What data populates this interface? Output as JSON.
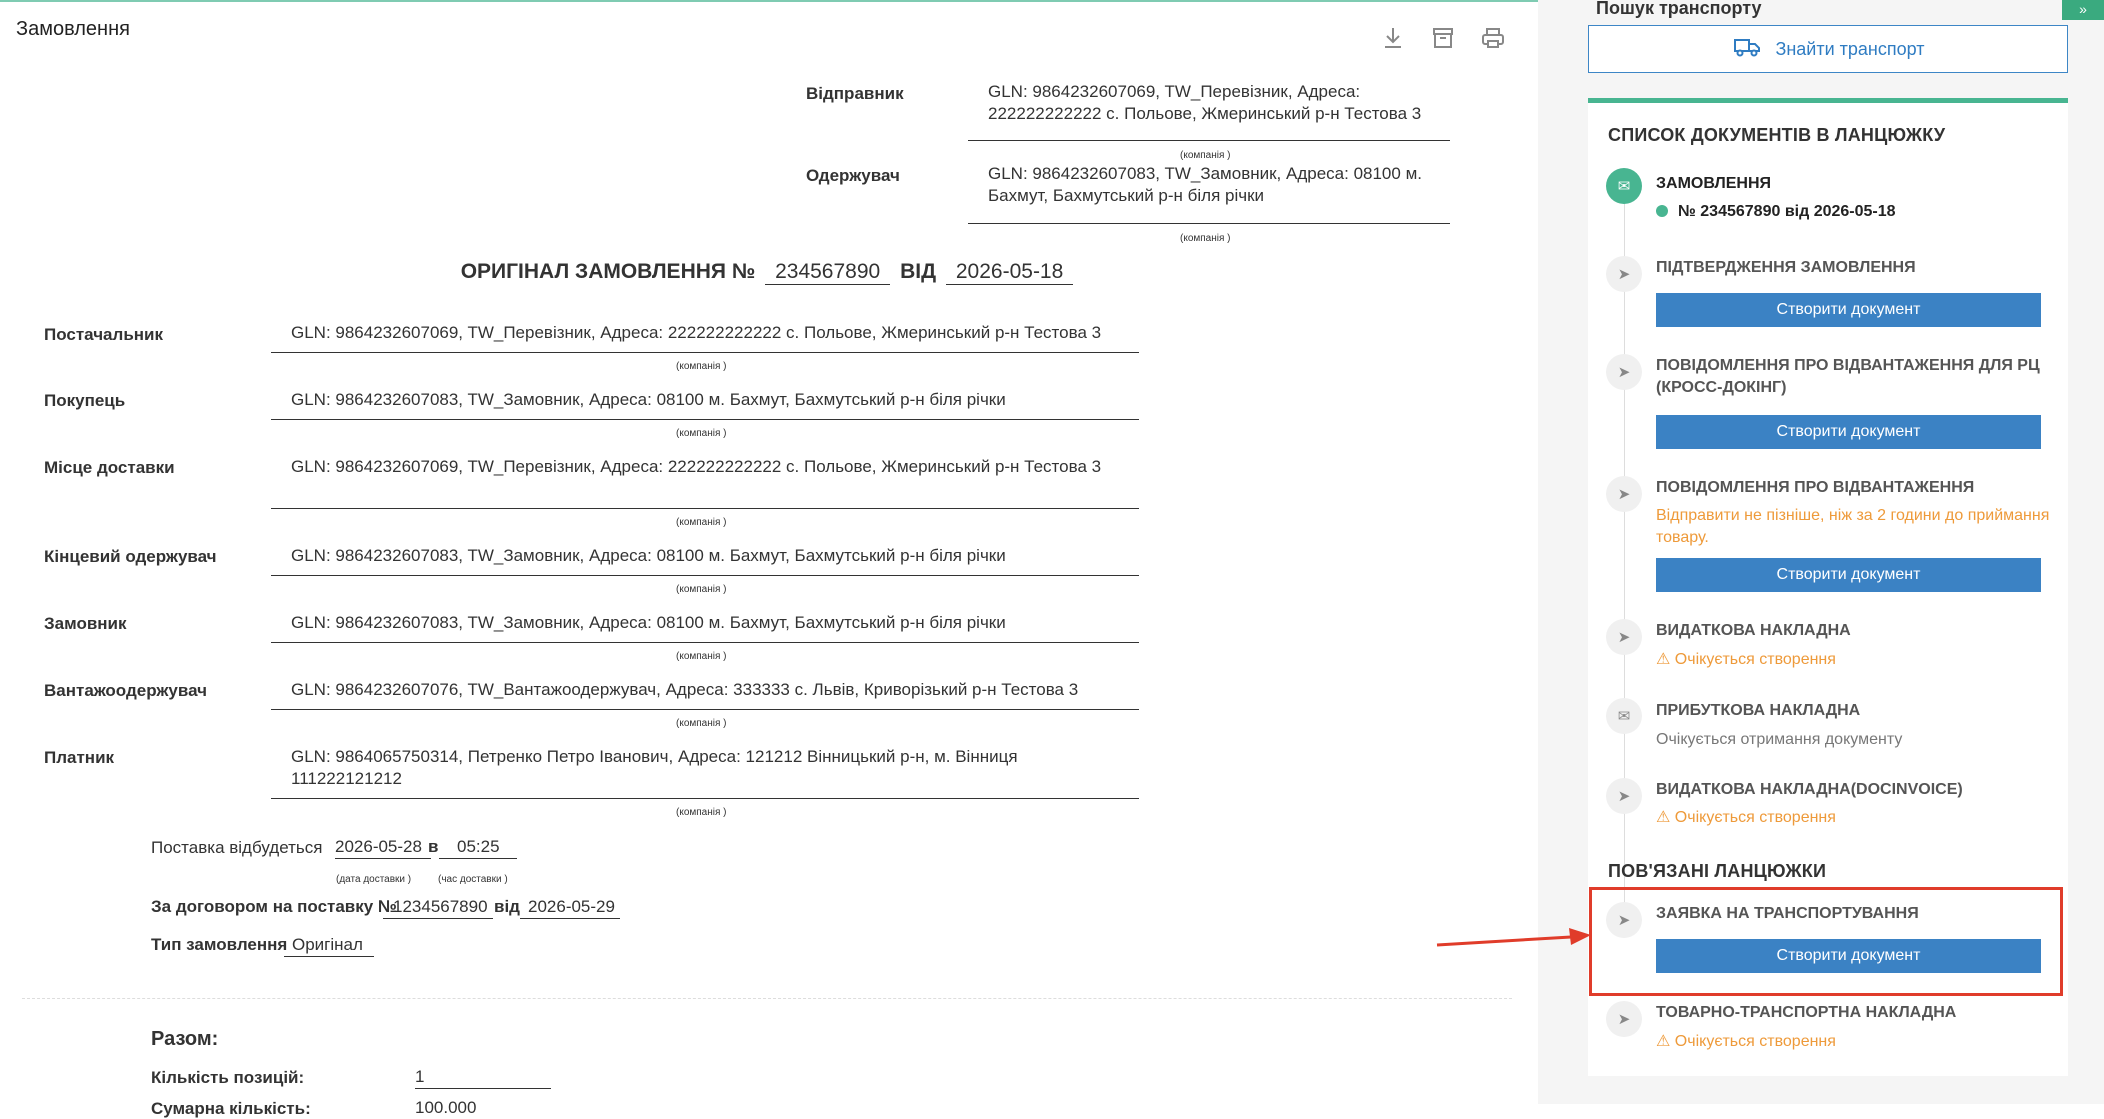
{
  "page": {
    "title": "Замовлення",
    "tool_icons": [
      "download-icon",
      "archive-icon",
      "print-icon"
    ]
  },
  "parties": {
    "caption": "(компанія )",
    "sender": {
      "label": "Відправник",
      "value": "GLN: 9864232607069, TW_Перевізник, Адреса: 222222222222 с. Польове, Жмеринський р-н Тестова 3"
    },
    "receiver": {
      "label": "Одержувач",
      "value": "GLN: 9864232607083, TW_Замовник, Адреса: 08100 м. Бахмут, Бахмутський р-н біля річки"
    }
  },
  "order_header": {
    "prefix": "ОРИГІНАЛ ЗАМОВЛЕННЯ №",
    "number": "234567890",
    "from": "ВІД",
    "date": "2026-05-18"
  },
  "fields": [
    {
      "label": "Постачальник",
      "value": "GLN: 9864232607069, TW_Перевізник, Адреса: 222222222222 с. Польове, Жмеринський р-н Тестова 3"
    },
    {
      "label": "Покупець",
      "value": "GLN: 9864232607083, TW_Замовник, Адреса: 08100 м. Бахмут, Бахмутський р-н біля річки"
    },
    {
      "label": "Місце доставки",
      "value": "GLN: 9864232607069, TW_Перевізник, Адреса: 222222222222 с. Польове, Жмеринський р-н Тестова 3"
    },
    {
      "label": "Кінцевий одержувач",
      "value": "GLN: 9864232607083, TW_Замовник, Адреса: 08100 м. Бахмут, Бахмутський р-н біля річки"
    },
    {
      "label": "Замовник",
      "value": "GLN: 9864232607083, TW_Замовник, Адреса: 08100 м. Бахмут, Бахмутський р-н біля річки"
    },
    {
      "label": "Вантажоодержувач",
      "value": "GLN: 9864232607076, TW_Вантажоодержувач, Адреса: 333333 с. Львів, Криворізький р-н Тестова 3"
    },
    {
      "label": "Платник",
      "value": "GLN: 9864065750314, Петренко Петро Іванович, Адреса: 121212 Вінницький р-н, м. Вінниця 111222121212"
    }
  ],
  "delivery": {
    "label": "Поставка відбудеться",
    "date": "2026-05-28",
    "at": "в",
    "time": "05:25",
    "date_caption": "(дата доставки )",
    "time_caption": "(час доставки )"
  },
  "contract": {
    "label": "За договором на поставку №",
    "number": "1234567890",
    "from": "від",
    "date": "2026-05-29"
  },
  "order_type": {
    "label": "Тип замовлення",
    "value": "Оригінал"
  },
  "totals": {
    "title": "Разом:",
    "positions_label": "Кількість позицій:",
    "positions_value": "1",
    "sum_label": "Сумарна кількість:",
    "sum_value": "100.000"
  },
  "sidebar": {
    "transport_search_title": "Пошук транспорту",
    "find_button": "Знайти транспорт",
    "chain_title": "СПИСОК ДОКУМЕНТІВ В ЛАНЦЮЖКУ",
    "create_button": "Створити документ",
    "items": [
      {
        "title": "ЗАМОВЛЕННЯ",
        "sub": "№ 234567890 від 2026-05-18",
        "icon": "envelope-icon"
      },
      {
        "title": "ПІДТВЕРДЖЕННЯ ЗАМОВЛЕННЯ",
        "icon": "send-icon"
      },
      {
        "title": "ПОВІДОМЛЕННЯ ПРО ВІДВАНТАЖЕННЯ ДЛЯ РЦ (КРОСС-ДОКІНГ)",
        "icon": "send-icon"
      },
      {
        "title": "ПОВІДОМЛЕННЯ ПРО ВІДВАНТАЖЕННЯ",
        "sub": "Відправити не пізніше, ніж за 2 години до приймання товару.",
        "icon": "send-icon"
      },
      {
        "title": "ВИДАТКОВА НАКЛАДНА",
        "sub": "Очікується створення",
        "icon": "send-icon"
      },
      {
        "title": "ПРИБУТКОВА НАКЛАДНА",
        "sub": "Очікується отримання документу",
        "icon": "envelope-icon"
      },
      {
        "title": "ВИДАТКОВА НАКЛАДНА(DOCINVOICE)",
        "sub": "Очікується створення",
        "icon": "send-icon"
      }
    ],
    "related_title": "ПОВ'ЯЗАНІ ЛАНЦЮЖКИ",
    "related": [
      {
        "title": "ЗАЯВКА НА ТРАНСПОРТУВАННЯ",
        "icon": "send-icon"
      },
      {
        "title": "ТОВАРНО-ТРАНСПОРТНА НАКЛАДНА",
        "sub": "Очікується створення",
        "icon": "send-icon"
      }
    ]
  },
  "colors": {
    "accent_green": "#48b591",
    "button_blue": "#3b82c4",
    "warning_orange": "#ee9a3a",
    "highlight_red": "#e03c2a"
  }
}
